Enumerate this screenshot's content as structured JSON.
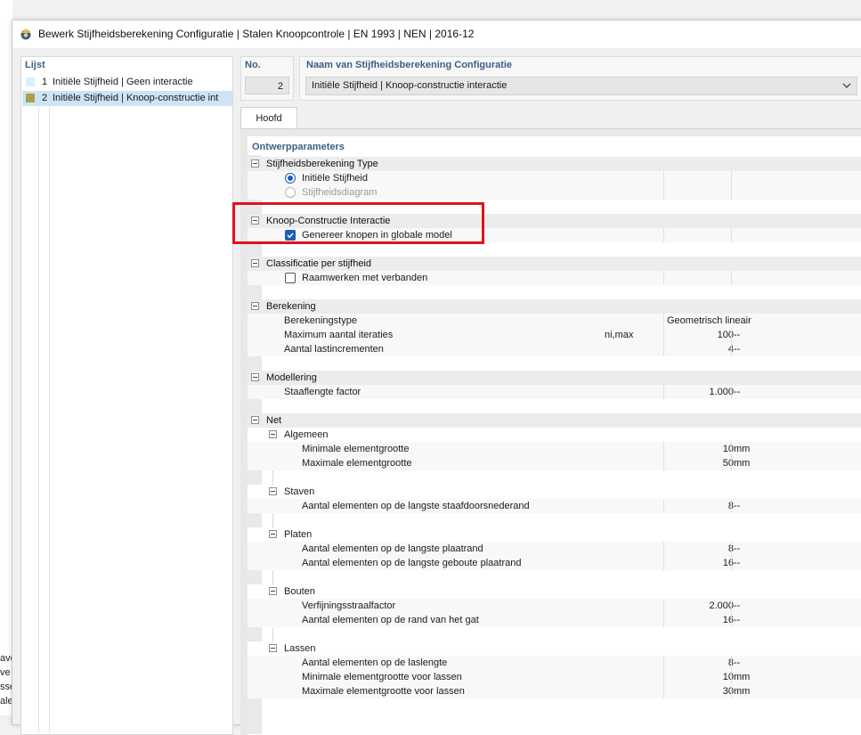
{
  "window": {
    "title": "Bewerk Stijfheidsberekening Configuratie | Stalen Knoopcontrole | EN 1993 | NEN | 2016-12"
  },
  "background_text": [
    "ave",
    "ve",
    "sse",
    "ale"
  ],
  "list": {
    "header": "Lijst",
    "items": [
      {
        "num": "1",
        "name": "Initiële Stijfheid | Geen interactie",
        "color": "#d8f1fb"
      },
      {
        "num": "2",
        "name": "Initiële Stijfheid | Knoop-constructie int",
        "color": "#a8a445"
      }
    ]
  },
  "no": {
    "label": "No.",
    "value": "2"
  },
  "name": {
    "label": "Naam van Stijfheidsberekening Configuratie",
    "value": "Initiële Stijfheid | Knoop-constructie interactie"
  },
  "tabs": [
    {
      "label": "Hoofd"
    }
  ],
  "grid": {
    "title": "Ontwerpparameters",
    "type_section": {
      "label": "Stijfheidsberekening Type",
      "opt1": "Initiële Stijfheid",
      "opt2": "Stijfheidsdiagram"
    },
    "interact_section": {
      "label": "Knoop-Constructie Interactie",
      "option": "Genereer knopen in globale model"
    },
    "class_section": {
      "label": "Classificatie per stijfheid",
      "option": "Raamwerken met verbanden"
    },
    "calc_section": {
      "label": "Berekening",
      "type_label": "Berekeningstype",
      "type_value": "Geometrisch lineair",
      "iter_label": "Maximum aantal iteraties",
      "iter_symbol": "ni,max",
      "iter_value": "100",
      "iter_unit": "--",
      "incr_label": "Aantal lastincrementen",
      "incr_value": "4",
      "incr_unit": "--"
    },
    "model_section": {
      "label": "Modellering",
      "factor_label": "Staaflengte factor",
      "factor_value": "1.000",
      "factor_unit": "--"
    },
    "net_section": {
      "label": "Net",
      "algemeen": {
        "label": "Algemeen",
        "min_label": "Minimale elementgrootte",
        "min_value": "10",
        "min_unit": "mm",
        "max_label": "Maximale elementgrootte",
        "max_value": "50",
        "max_unit": "mm"
      },
      "staven": {
        "label": "Staven",
        "count_label": "Aantal elementen op de langste staafdoorsnederand",
        "count_value": "8",
        "count_unit": "--"
      },
      "platen": {
        "label": "Platen",
        "a_label": "Aantal elementen op de langste plaatrand",
        "a_value": "8",
        "a_unit": "--",
        "b_label": "Aantal elementen op de langste geboute plaatrand",
        "b_value": "16",
        "b_unit": "--"
      },
      "bouten": {
        "label": "Bouten",
        "a_label": "Verfijningsstraalfactor",
        "a_value": "2.000",
        "a_unit": "--",
        "b_label": "Aantal elementen op de rand van het gat",
        "b_value": "16",
        "b_unit": "--"
      },
      "lassen": {
        "label": "Lassen",
        "a_label": "Aantal elementen op de laslengte",
        "a_value": "8",
        "a_unit": "--",
        "b_label": "Minimale elementgrootte voor lassen",
        "b_value": "10",
        "b_unit": "mm",
        "c_label": "Maximale elementgrootte voor lassen",
        "c_value": "30",
        "c_unit": "mm"
      }
    }
  }
}
